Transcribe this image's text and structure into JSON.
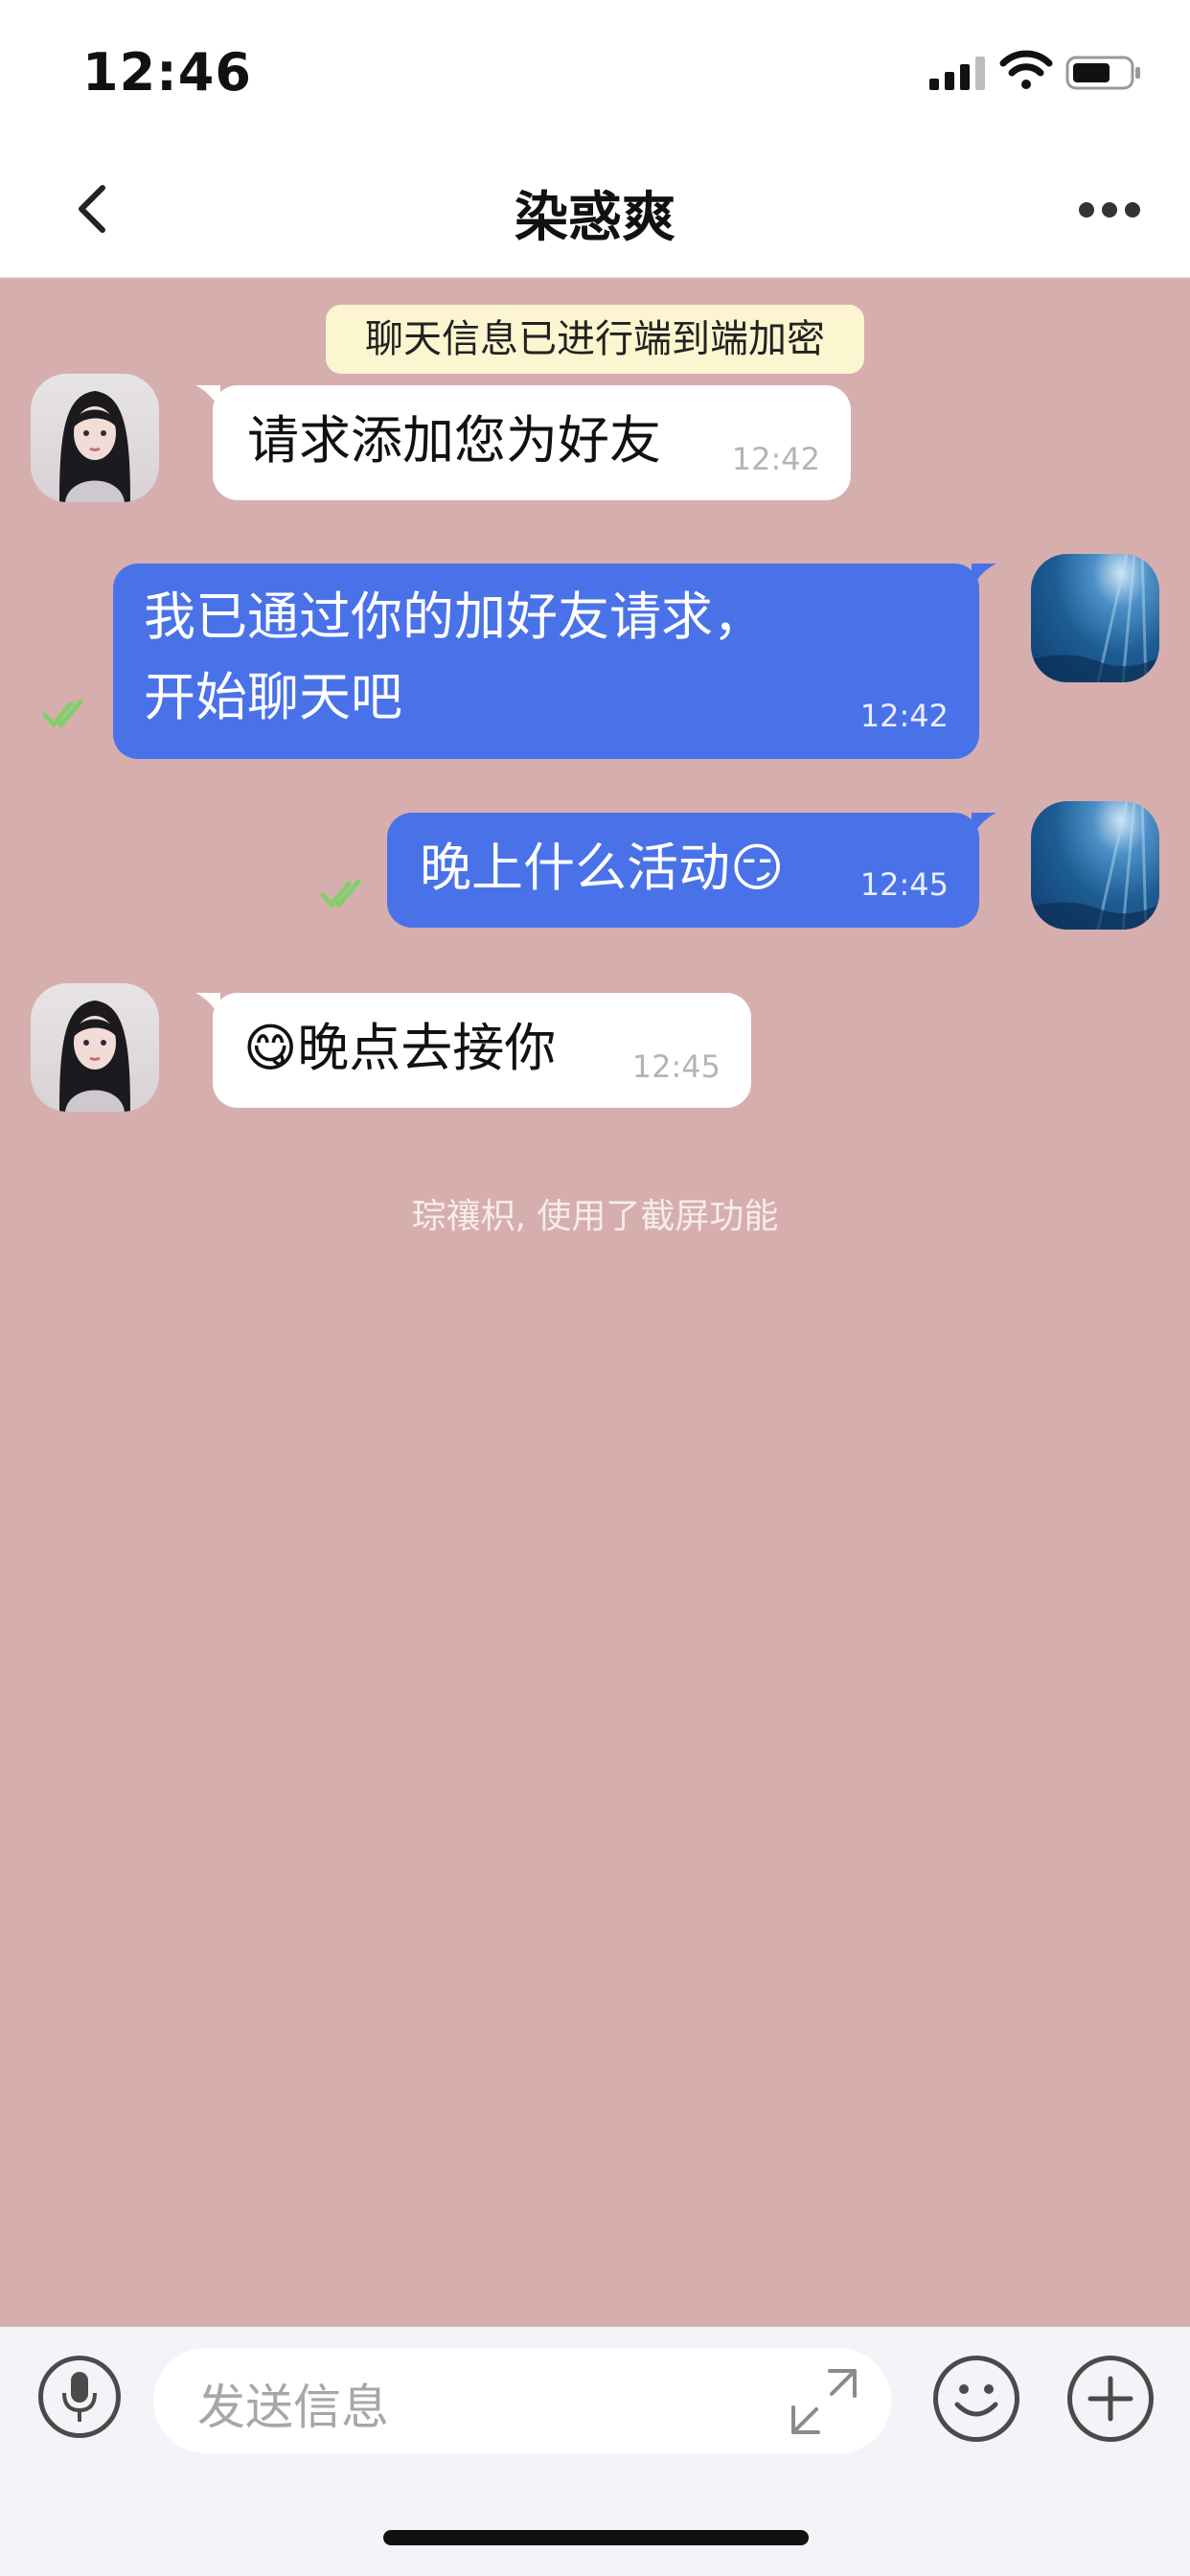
{
  "status_bar": {
    "time": "12:46"
  },
  "header": {
    "title": "染惑爽",
    "back_icon": "chevron-left-icon",
    "more_icon": "more-horizontal-icon"
  },
  "chat": {
    "encryption_notice": "聊天信息已进行端到端加密",
    "messages": [
      {
        "direction": "incoming",
        "text": "请求添加您为好友",
        "time": "12:42",
        "avatar": "girl-avatar"
      },
      {
        "direction": "outgoing",
        "text": "我已通过你的加好友请求，\n开始聊天吧",
        "time": "12:42",
        "avatar": "sea-avatar",
        "status": "read"
      },
      {
        "direction": "outgoing",
        "text": "晚上什么活动😏",
        "time": "12:45",
        "avatar": "sea-avatar",
        "status": "read"
      },
      {
        "direction": "incoming",
        "text": "😋晚点去接你",
        "time": "12:45",
        "avatar": "girl-avatar"
      }
    ],
    "system_note": "琮禳枳, 使用了截屏功能"
  },
  "input_bar": {
    "placeholder": "发送信息",
    "icons": [
      "microphone-icon",
      "expand-icon",
      "smiley-icon",
      "plus-icon"
    ]
  },
  "colors": {
    "chat_background": "#d7aeae",
    "outgoing_bubble": "#4a72e8",
    "incoming_bubble": "#ffffff",
    "notice_background": "#fbf6cf",
    "read_tick": "#7fd06a"
  }
}
